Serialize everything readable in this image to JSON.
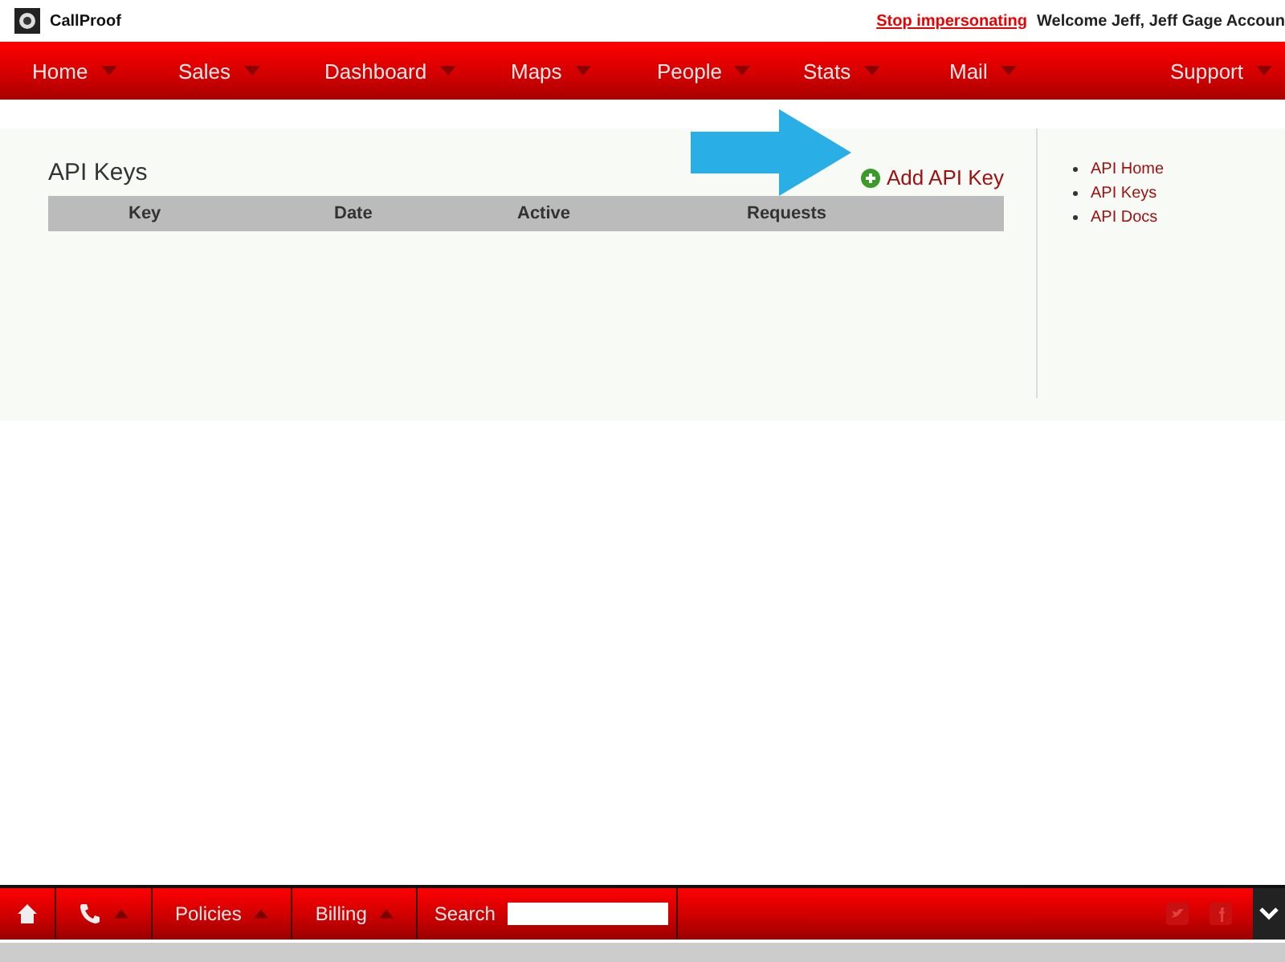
{
  "header": {
    "logo_text": "CallProof",
    "stop_link": "Stop impersonating",
    "welcome": "Welcome Jeff, Jeff Gage Accoun"
  },
  "nav": [
    "Home",
    "Sales",
    "Dashboard",
    "Maps",
    "People",
    "Stats",
    "Mail",
    "Support"
  ],
  "page": {
    "title": "API Keys",
    "add_button": "Add API Key",
    "columns": [
      "Key",
      "Date",
      "Active",
      "Requests"
    ]
  },
  "sidebar": {
    "links": [
      "API Home",
      "API Keys",
      "API Docs"
    ]
  },
  "bottom_bar": {
    "items": [
      {
        "kind": "home"
      },
      {
        "kind": "phone"
      },
      {
        "kind": "menu",
        "label": "Policies"
      },
      {
        "kind": "menu",
        "label": "Billing"
      },
      {
        "kind": "search",
        "label": "Search"
      }
    ]
  }
}
